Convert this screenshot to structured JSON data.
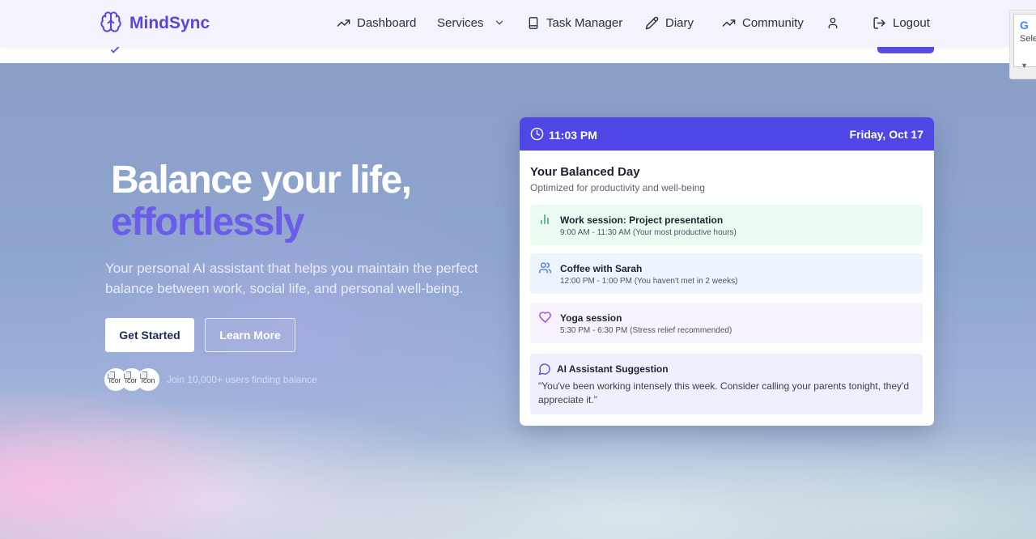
{
  "brand": {
    "name": "MindSync",
    "color": "#5b45d8"
  },
  "nav": {
    "items": [
      {
        "label": "Dashboard",
        "icon": "trending-up-icon"
      },
      {
        "label": "Services",
        "icon": "chevron-down-icon"
      },
      {
        "label": "Task Manager",
        "icon": "tablet-icon"
      },
      {
        "label": "Diary",
        "icon": "pencil-icon"
      },
      {
        "label": "Community",
        "icon": "trending-up-icon"
      },
      {
        "label": "",
        "icon": "user-icon"
      },
      {
        "label": "Logout",
        "icon": "logout-icon"
      }
    ]
  },
  "translate_widget": {
    "logo": "G",
    "text": "Sele"
  },
  "hero": {
    "headline": "Balance your life,",
    "headline_accent": "effortlessly",
    "subtext": "Your personal AI assistant that helps you maintain the perfect balance between work, social life, and personal well-being.",
    "primary_button": "Get Started",
    "secondary_button": "Learn More",
    "avatar_alt": "Icon",
    "users_note": "Join 10,000+ users finding balance"
  },
  "schedule_card": {
    "time": "11:03 PM",
    "date": "Friday, Oct 17",
    "header_color": "#4f46e5",
    "title": "Your Balanced Day",
    "subtitle": "Optimized for productivity and well-being",
    "events": [
      {
        "title": "Work session: Project presentation",
        "time": "9:00 AM - 11:30 AM (Your most productive hours)",
        "icon": "bar-chart-icon",
        "bg": "#ecfbf1",
        "icon_color": "#22a05a"
      },
      {
        "title": "Coffee with Sarah",
        "time": "12:00 PM - 1:00 PM (You haven't met in 2 weeks)",
        "icon": "users-icon",
        "bg": "#edf4fe",
        "icon_color": "#3b73d9"
      },
      {
        "title": "Yoga session",
        "time": "5:30 PM - 6:30 PM (Stress relief recommended)",
        "icon": "heart-icon",
        "bg": "#f8f2fd",
        "icon_color": "#9a3bd6"
      }
    ],
    "suggestion": {
      "title": "AI Assistant Suggestion",
      "text": "\"You've been working intensely this week. Consider calling your parents tonight, they'd appreciate it.\"",
      "icon": "message-circle-icon"
    }
  }
}
